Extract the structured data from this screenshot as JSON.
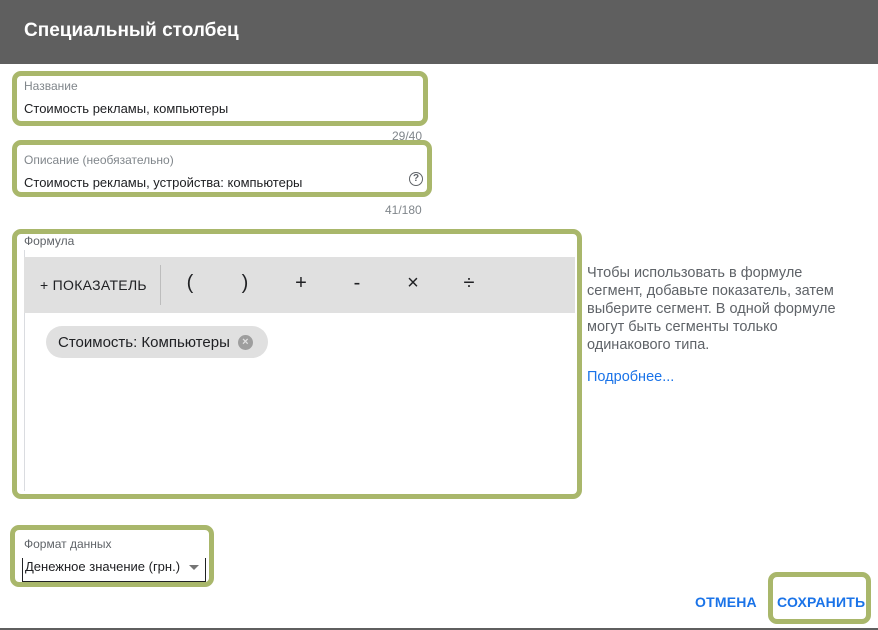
{
  "dialog": {
    "title": "Специальный столбец"
  },
  "name_field": {
    "label": "Название",
    "value": "Стоимость рекламы, компьютеры",
    "counter": "29/40"
  },
  "description_field": {
    "label": "Описание (необязательно)",
    "value": "Стоимость рекламы, устройства: компьютеры",
    "counter": "41/180",
    "help_icon": "help-circle-icon"
  },
  "formula": {
    "label": "Формула",
    "toolbar": {
      "metric_button": "+ ПОКАЗАТЕЛЬ",
      "operators": [
        "(",
        ")",
        "+",
        "-",
        "×",
        "÷"
      ]
    },
    "chip": {
      "label": "Стоимость: Компьютеры",
      "close_icon": "close-circle-icon"
    }
  },
  "side_help": {
    "text": "Чтобы использовать в формуле сегмент, добавьте показатель, затем выберите сегмент. В одной формуле могут быть сегменты только одинакового типа.",
    "link": "Подробнее..."
  },
  "data_format": {
    "label": "Формат данных",
    "value": "Денежное значение (грн.)"
  },
  "actions": {
    "cancel": "ОТМЕНА",
    "save": "СОХРАНИТЬ"
  },
  "colors": {
    "header_bg": "#5f5f5f",
    "highlight": "#a9b76b",
    "accent": "#1a73e8"
  }
}
